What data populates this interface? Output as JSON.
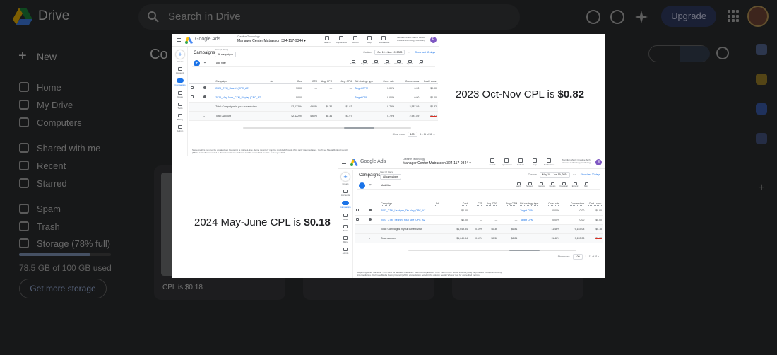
{
  "drive": {
    "app_name": "Drive",
    "search_placeholder": "Search in Drive",
    "upgrade_label": "Upgrade",
    "new_label": "New",
    "nav": [
      {
        "label": "Home",
        "icon": "home-icon"
      },
      {
        "label": "My Drive",
        "icon": "drive-icon"
      },
      {
        "label": "Computers",
        "icon": "computer-icon"
      },
      {
        "label": "Shared with me",
        "icon": "people-icon"
      },
      {
        "label": "Recent",
        "icon": "clock-icon"
      },
      {
        "label": "Starred",
        "icon": "star-icon"
      },
      {
        "label": "Spam",
        "icon": "spam-icon"
      },
      {
        "label": "Trash",
        "icon": "trash-icon"
      },
      {
        "label": "Storage (78% full)",
        "icon": "cloud-icon"
      }
    ],
    "storage_fraction": 0.78,
    "storage_text": "78.5 GB of 100 GB used",
    "get_storage_label": "Get more storage",
    "main_title_fragment": "Co",
    "file_caption": "CPL is $0.18",
    "colors": {
      "background": "#2f3033",
      "accent": "#a9c0f0",
      "upgrade": "#34416b"
    }
  },
  "preview": {
    "label_top": {
      "prefix": "2023 Oct-Nov CPL is ",
      "value": "$0.82"
    },
    "label_bottom": {
      "prefix": "2024 May-June CPL is ",
      "value": "$0.18"
    },
    "shot1": {
      "brand": "Google Ads",
      "account_line1": "Creative Technology",
      "account_line2": "Manager Center Matrasson   324-117-9344  ▾",
      "tools": [
        "Search",
        "Appearance",
        "Refresh",
        "Help",
        "Notifications"
      ],
      "account_right": "Meridian Matrix wayne Hesko creative technology marketing",
      "avatar_letter": "E",
      "page_title": "Campaigns",
      "filter_caption": "View (2 filters)",
      "filter_value": "All campaigns",
      "custom_label": "Custom",
      "date_range": "Oct 19 – Nov 19, 2023",
      "show_last": "Show last 30 days",
      "add_filter": "Add filter",
      "table_tools": [
        "Search",
        "Segment",
        "Columns",
        "Reports",
        "Download",
        "Expand",
        "More"
      ],
      "columns": [
        "Campaign",
        "Ad",
        "Cost",
        "CTR",
        "Avg. CPC",
        "Avg. CPM",
        "Bid strategy type",
        "Conv. rate",
        "Conversions",
        "Cost / conv."
      ],
      "rows": [
        {
          "name": "2023_CTM_Search (CPC_AZ",
          "ad": "",
          "cost": "$0.00",
          "ctr": "—",
          "cpc": "—",
          "cpm": "—",
          "bid": "Target CPM",
          "conv_rate": "0.00%",
          "conv": "0.00",
          "cost_conv": "$0.00"
        },
        {
          "name": "2023_May June_CTM_Display (CPC_AZ",
          "ad": "",
          "cost": "$0.00",
          "ctr": "—",
          "cpc": "—",
          "cpm": "—",
          "bid": "Target CPA",
          "conv_rate": "0.00%",
          "conv": "0.00",
          "cost_conv": "$0.00"
        }
      ],
      "total_rows": [
        {
          "label": "Total: Campaigns in your current view",
          "cost": "$2,122.94",
          "ctr": "4.60%",
          "cpc": "$0.34",
          "cpm": "$1.97",
          "conv_rate": "0.79%",
          "conv": "2,587.89",
          "cost_conv": "$0.82"
        },
        {
          "label": "Total: Account",
          "cost": "$2,122.94",
          "ctr": "4.60%",
          "cpc": "$0.34",
          "cpm": "$1.97",
          "conv_rate": "0.79%",
          "conv": "2,587.89",
          "cost_conv": "$0.82"
        }
      ],
      "show_rows_label": "Show rows",
      "show_rows_value": "100",
      "page_range": "1 - 11 of 11",
      "footnote": "Some metrics may not be updated yet. Reporting is not real-time. Some inventory may be provided through third party intermediaries. You'll see Media Rating Council (MRC) accreditation noted in the column header's hover text for accredited metrics.",
      "footnote_date": "© Google, 2023."
    },
    "shot2": {
      "brand": "Google Ads",
      "account_line1": "Creative Technology",
      "account_line2": "Manager Center Matrasson   324-117-9344  ▾",
      "tools": [
        "Search",
        "Appearance",
        "Refresh",
        "Help",
        "Notifications"
      ],
      "account_right": "Meridian Matrix Creative Tech creative technology marketing",
      "avatar_letter": "E",
      "page_title": "Campaigns",
      "filter_caption": "View (2 filters)",
      "filter_value": "All campaigns",
      "custom_label": "Custom",
      "date_range": "May 19 – Jun 19, 2024",
      "show_last": "Show last 30 days",
      "add_filter": "Add filter",
      "table_tools": [
        "Search",
        "Segment",
        "Columns",
        "Reports",
        "Download",
        "Expand",
        "More"
      ],
      "columns": [
        "Campaign",
        "Ad",
        "Cost",
        "CTR",
        "Avg. CPC",
        "Avg. CPM",
        "Bid strategy type",
        "Conv. rate",
        "Conversions",
        "Cost / conv."
      ],
      "rows": [
        {
          "name": "2023_CTM_Leadgen_Dis play_CPC_AZ",
          "ad": "",
          "cost": "$0.00",
          "ctr": "—",
          "cpc": "—",
          "cpm": "—",
          "bid": "Target CPA",
          "conv_rate": "0.00%",
          "conv": "0.00",
          "cost_conv": "$0.00"
        },
        {
          "name": "2023_CTM_Search_YouT ube_CPC_AZ",
          "ad": "",
          "cost": "$0.00",
          "ctr": "—",
          "cpc": "—",
          "cpm": "—",
          "bid": "Target CPM",
          "conv_rate": "0.00%",
          "conv": "0.00",
          "cost_conv": "$0.00"
        }
      ],
      "total_rows": [
        {
          "label": "Total: Campaigns in your current view",
          "cost": "$1,649.34",
          "ctr": "0.19%",
          "cpc": "$0.36",
          "cpm": "$6.81",
          "conv_rate": "11.46%",
          "conv": "9,153.08",
          "cost_conv": "$0.18"
        },
        {
          "label": "Total: Account",
          "cost": "$1,649.34",
          "ctr": "0.19%",
          "cpc": "$0.36",
          "cpm": "$6.81",
          "conv_rate": "11.46%",
          "conv": "9,153.08",
          "cost_conv": "$0.18"
        }
      ],
      "show_rows_label": "Show rows",
      "show_rows_value": "100",
      "page_range": "1 - 11 of 11",
      "footnote": "Reporting is not real-time. Time zone for all dates and times: (GMT-05:00) Eastern Time. Learn more. Some inventory may be provided through third party intermediaries. You'll see Media Rating Council (MRC) accreditation noted in the column header's hover text for accredited metrics.",
      "footnote_date": ""
    }
  }
}
